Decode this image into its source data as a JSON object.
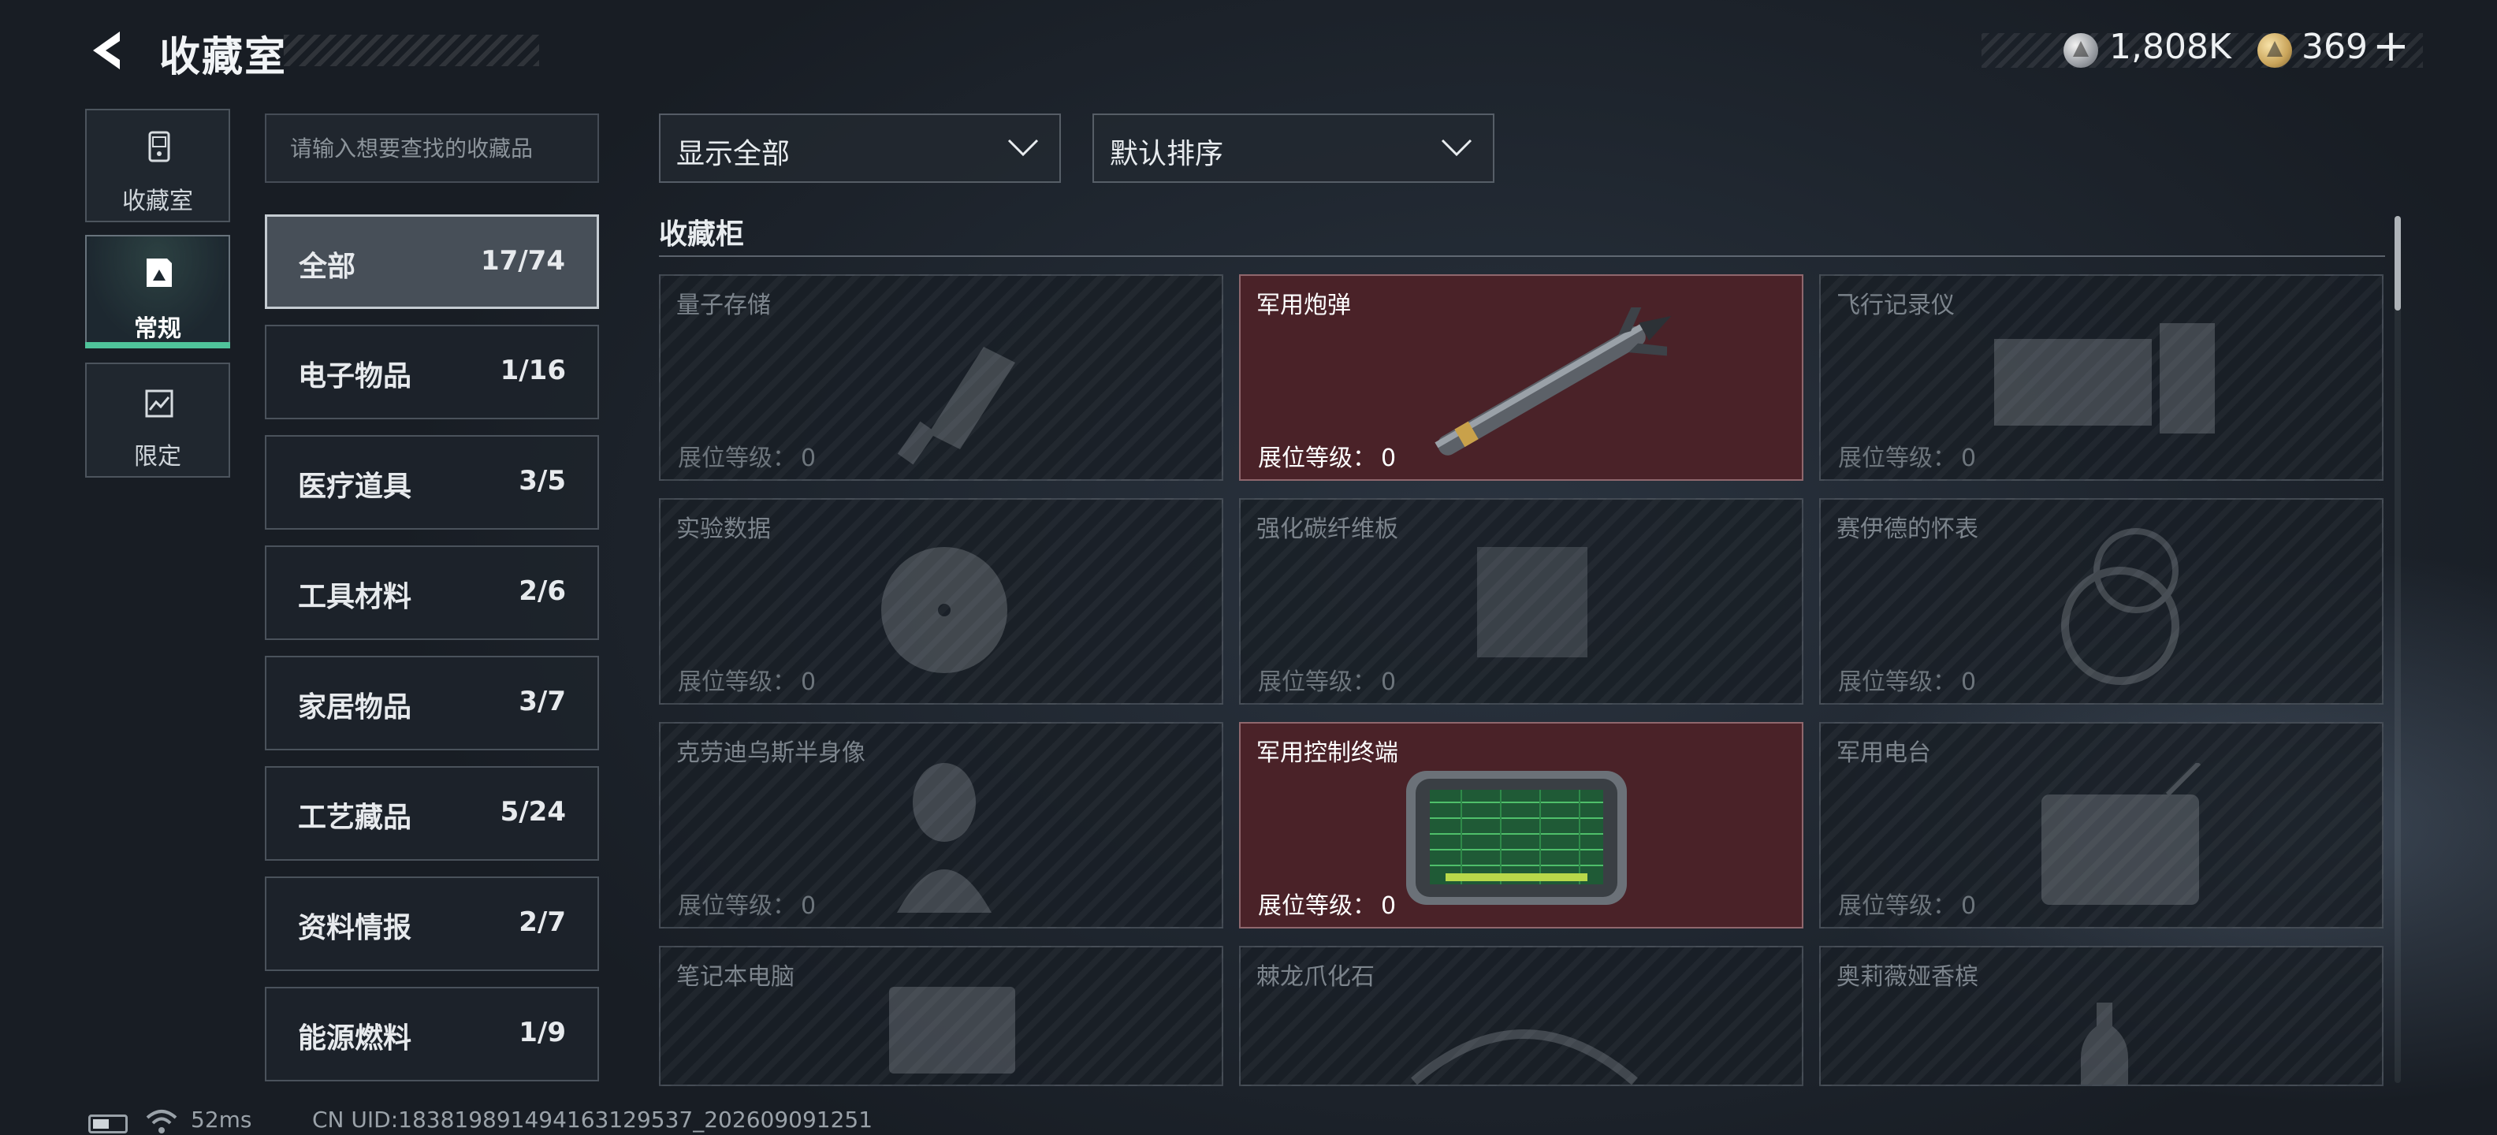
{
  "header": {
    "title": "收藏室",
    "currency": [
      {
        "icon": "silver-coin-icon",
        "value": "1,808K"
      },
      {
        "icon": "gold-coin-icon",
        "value": "369"
      }
    ],
    "plus_label": "+"
  },
  "side_nav": [
    {
      "label": "收藏室",
      "icon": "collection-room-icon",
      "active": false
    },
    {
      "label": "常规",
      "icon": "regular-icon",
      "active": true
    },
    {
      "label": "限定",
      "icon": "limited-icon",
      "active": false
    }
  ],
  "search": {
    "placeholder": "请输入想要查找的收藏品"
  },
  "categories": [
    {
      "name": "全部",
      "count": "17/74",
      "active": true
    },
    {
      "name": "电子物品",
      "count": "1/16"
    },
    {
      "name": "医疗道具",
      "count": "3/5"
    },
    {
      "name": "工具材料",
      "count": "2/6"
    },
    {
      "name": "家居物品",
      "count": "3/7"
    },
    {
      "name": "工艺藏品",
      "count": "5/24"
    },
    {
      "name": "资料情报",
      "count": "2/7"
    },
    {
      "name": "能源燃料",
      "count": "1/9"
    }
  ],
  "filters": {
    "display": "显示全部",
    "sort": "默认排序"
  },
  "cabinet": {
    "title": "收藏柜",
    "level_label": "展位等级：",
    "items": [
      {
        "name": "量子存储",
        "level": "0",
        "owned": false
      },
      {
        "name": "军用炮弹",
        "level": "0",
        "owned": true
      },
      {
        "name": "飞行记录仪",
        "level": "0",
        "owned": false
      },
      {
        "name": "实验数据",
        "level": "0",
        "owned": false
      },
      {
        "name": "强化碳纤维板",
        "level": "0",
        "owned": false
      },
      {
        "name": "赛伊德的怀表",
        "level": "0",
        "owned": false
      },
      {
        "name": "克劳迪乌斯半身像",
        "level": "0",
        "owned": false
      },
      {
        "name": "军用控制终端",
        "level": "0",
        "owned": true
      },
      {
        "name": "军用电台",
        "level": "0",
        "owned": false
      },
      {
        "name": "笔记本电脑",
        "level": "",
        "owned": false
      },
      {
        "name": "棘龙爪化石",
        "level": "",
        "owned": false
      },
      {
        "name": "奥莉薇娅香槟",
        "level": "",
        "owned": false
      }
    ]
  },
  "status_bar": {
    "ping": "52ms",
    "uid": "CN UID:183819891494163129537_202609091251"
  },
  "colors": {
    "accent": "#4fc39a",
    "owned_card": "#4a2228",
    "panel": "#1e242c"
  }
}
